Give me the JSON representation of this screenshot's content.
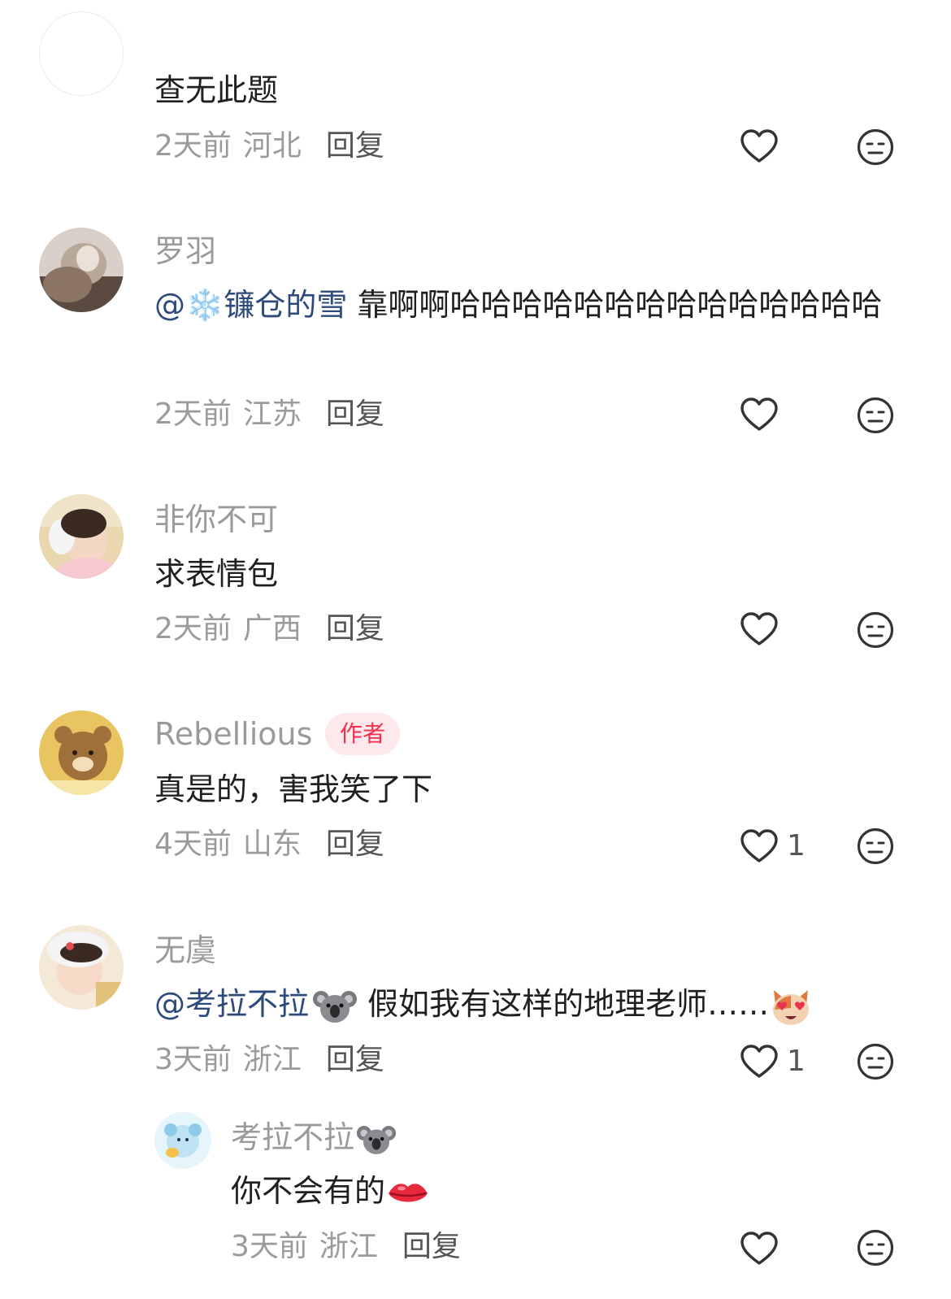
{
  "comments": [
    {
      "username": "",
      "text": "查无此题",
      "time": "2天前",
      "location": "河北",
      "reply": "回复",
      "likes": ""
    },
    {
      "username": "罗羽",
      "mention": "@❄️镰仓的雪",
      "text": " 靠啊啊哈哈哈哈哈哈哈哈哈哈哈哈哈哈",
      "time": "2天前",
      "location": "江苏",
      "reply": "回复",
      "likes": ""
    },
    {
      "username": "非你不可",
      "text": "求表情包",
      "time": "2天前",
      "location": "广西",
      "reply": "回复",
      "likes": ""
    },
    {
      "username": "Rebellious",
      "badge": "作者",
      "text": "真是的，害我笑了下",
      "time": "4天前",
      "location": "山东",
      "reply": "回复",
      "likes": "1"
    },
    {
      "username": "无虞",
      "mention": "@考拉不拉",
      "text": "  假如我有这样的地理老师……",
      "time": "3天前",
      "location": "浙江",
      "reply": "回复",
      "likes": "1"
    },
    {
      "username": "考拉不拉",
      "text": "你不会有的",
      "time": "3天前",
      "location": "浙江",
      "reply": "回复",
      "likes": ""
    }
  ],
  "icons": {
    "like": "heart-outline-icon",
    "dislike": "neutral-face-icon"
  },
  "colors": {
    "mention": "#2d4a7b",
    "badge_text": "#f5304f",
    "badge_bg": "#fde8ec",
    "meta": "#9b9b9b"
  }
}
